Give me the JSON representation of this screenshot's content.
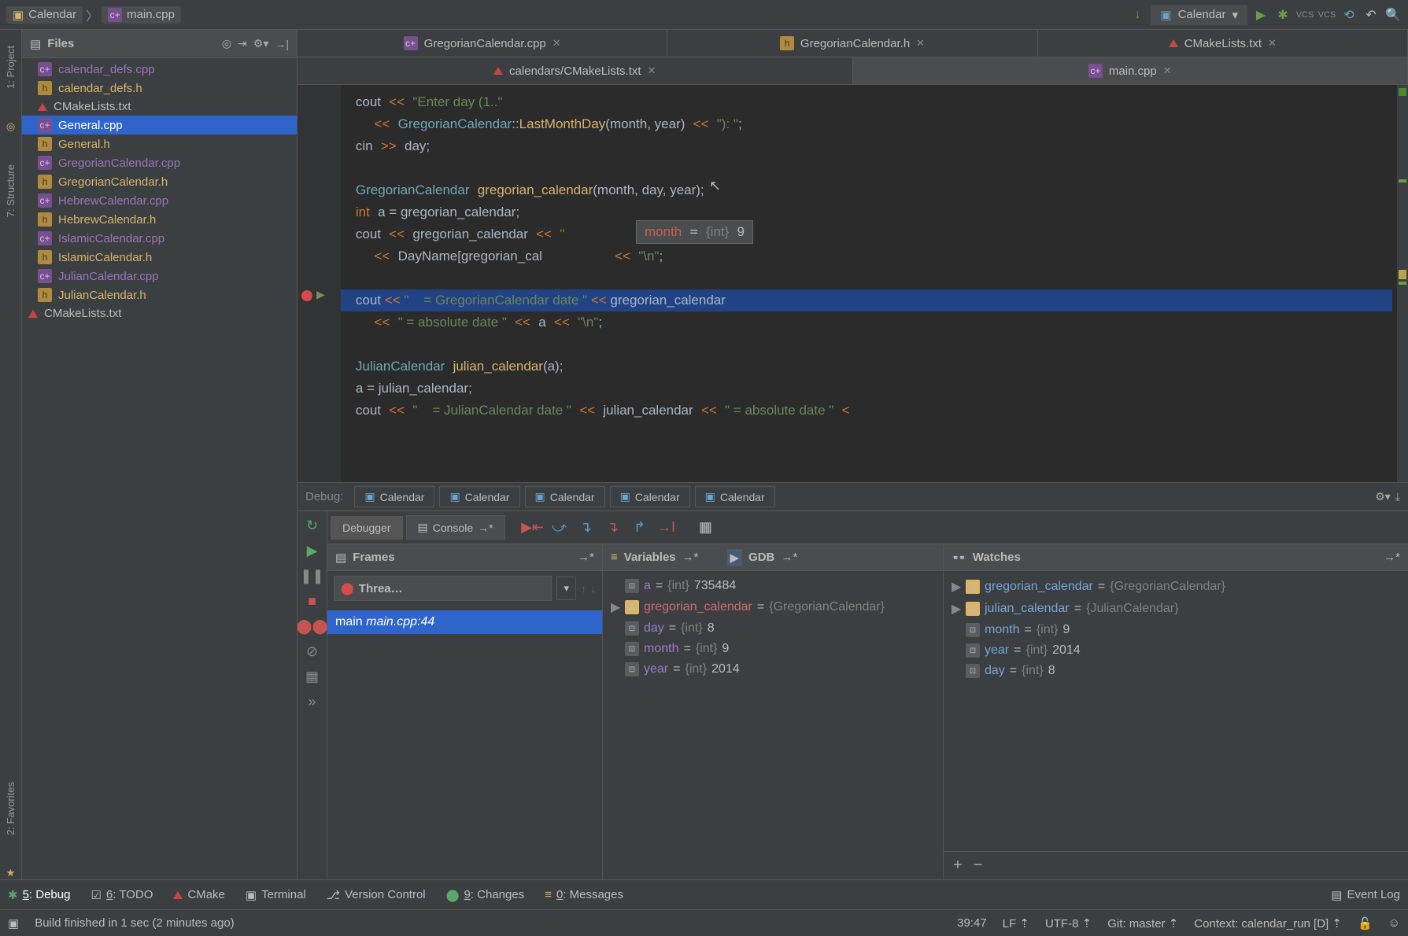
{
  "toolbar": {
    "breadcrumb_project": "Calendar",
    "breadcrumb_file": "main.cpp",
    "run_config": "Calendar",
    "vcs1": "VCS",
    "vcs2": "VCS"
  },
  "leftStrip": {
    "project": "1: Project",
    "structure": "7: Structure",
    "favorites": "2: Favorites"
  },
  "projectPanel": {
    "title": "Files",
    "files": [
      {
        "name": "calendar_defs.cpp",
        "type": "cpp"
      },
      {
        "name": "calendar_defs.h",
        "type": "h"
      },
      {
        "name": "CMakeLists.txt",
        "type": "cmake"
      },
      {
        "name": "General.cpp",
        "type": "cpp",
        "selected": true
      },
      {
        "name": "General.h",
        "type": "h"
      },
      {
        "name": "GregorianCalendar.cpp",
        "type": "cpp"
      },
      {
        "name": "GregorianCalendar.h",
        "type": "h"
      },
      {
        "name": "HebrewCalendar.cpp",
        "type": "cpp"
      },
      {
        "name": "HebrewCalendar.h",
        "type": "h"
      },
      {
        "name": "IslamicCalendar.cpp",
        "type": "cpp"
      },
      {
        "name": "IslamicCalendar.h",
        "type": "h"
      },
      {
        "name": "JulianCalendar.cpp",
        "type": "cpp"
      },
      {
        "name": "JulianCalendar.h",
        "type": "h"
      },
      {
        "name": "CMakeLists.txt",
        "type": "cmake",
        "indent": true
      }
    ]
  },
  "editor": {
    "tabsRow1": [
      {
        "name": "GregorianCalendar.cpp",
        "type": "cpp"
      },
      {
        "name": "GregorianCalendar.h",
        "type": "h"
      },
      {
        "name": "CMakeLists.txt",
        "type": "cmake"
      }
    ],
    "tabsRow2": [
      {
        "name": "calendars/CMakeLists.txt",
        "type": "cmake"
      },
      {
        "name": "main.cpp",
        "type": "cpp",
        "active": true
      }
    ],
    "tooltip": {
      "name": "month",
      "type": "{int}",
      "value": "9"
    }
  },
  "debug": {
    "label": "Debug:",
    "configs": [
      "Calendar",
      "Calendar",
      "Calendar",
      "Calendar",
      "Calendar"
    ],
    "tabDebugger": "Debugger",
    "tabConsole": "Console",
    "frames": {
      "title": "Frames",
      "thread": "Threa…",
      "items": [
        {
          "name": "main",
          "loc": "main.cpp:44",
          "selected": true
        }
      ]
    },
    "variables": {
      "title": "Variables",
      "gdb": "GDB",
      "items": [
        {
          "name": "a",
          "type": "{int}",
          "value": "735484",
          "cls": "a"
        },
        {
          "name": "gregorian_calendar",
          "type": "{GregorianCalendar}",
          "value": "",
          "cls": "b",
          "expandable": true
        },
        {
          "name": "day",
          "type": "{int}",
          "value": "8",
          "cls": "a"
        },
        {
          "name": "month",
          "type": "{int}",
          "value": "9",
          "cls": "a"
        },
        {
          "name": "year",
          "type": "{int}",
          "value": "2014",
          "cls": "a"
        }
      ]
    },
    "watches": {
      "title": "Watches",
      "items": [
        {
          "name": "gregorian_calendar",
          "type": "{GregorianCalendar}",
          "value": "",
          "cls": "c",
          "expandable": true
        },
        {
          "name": "julian_calendar",
          "type": "{JulianCalendar}",
          "value": "",
          "cls": "c",
          "expandable": true
        },
        {
          "name": "month",
          "type": "{int}",
          "value": "9",
          "cls": "c"
        },
        {
          "name": "year",
          "type": "{int}",
          "value": "2014",
          "cls": "c"
        },
        {
          "name": "day",
          "type": "{int}",
          "value": "8",
          "cls": "c"
        }
      ]
    }
  },
  "bottomTools": {
    "debug": "5: Debug",
    "todo": "6: TODO",
    "cmake": "CMake",
    "terminal": "Terminal",
    "vcs": "Version Control",
    "changes": "9: Changes",
    "messages": "0: Messages",
    "eventlog": "Event Log"
  },
  "statusBar": {
    "message": "Build finished in 1 sec (2 minutes ago)",
    "pos": "39:47",
    "lf": "LF",
    "enc": "UTF-8",
    "git": "Git: master",
    "context": "Context: calendar_run [D]"
  }
}
